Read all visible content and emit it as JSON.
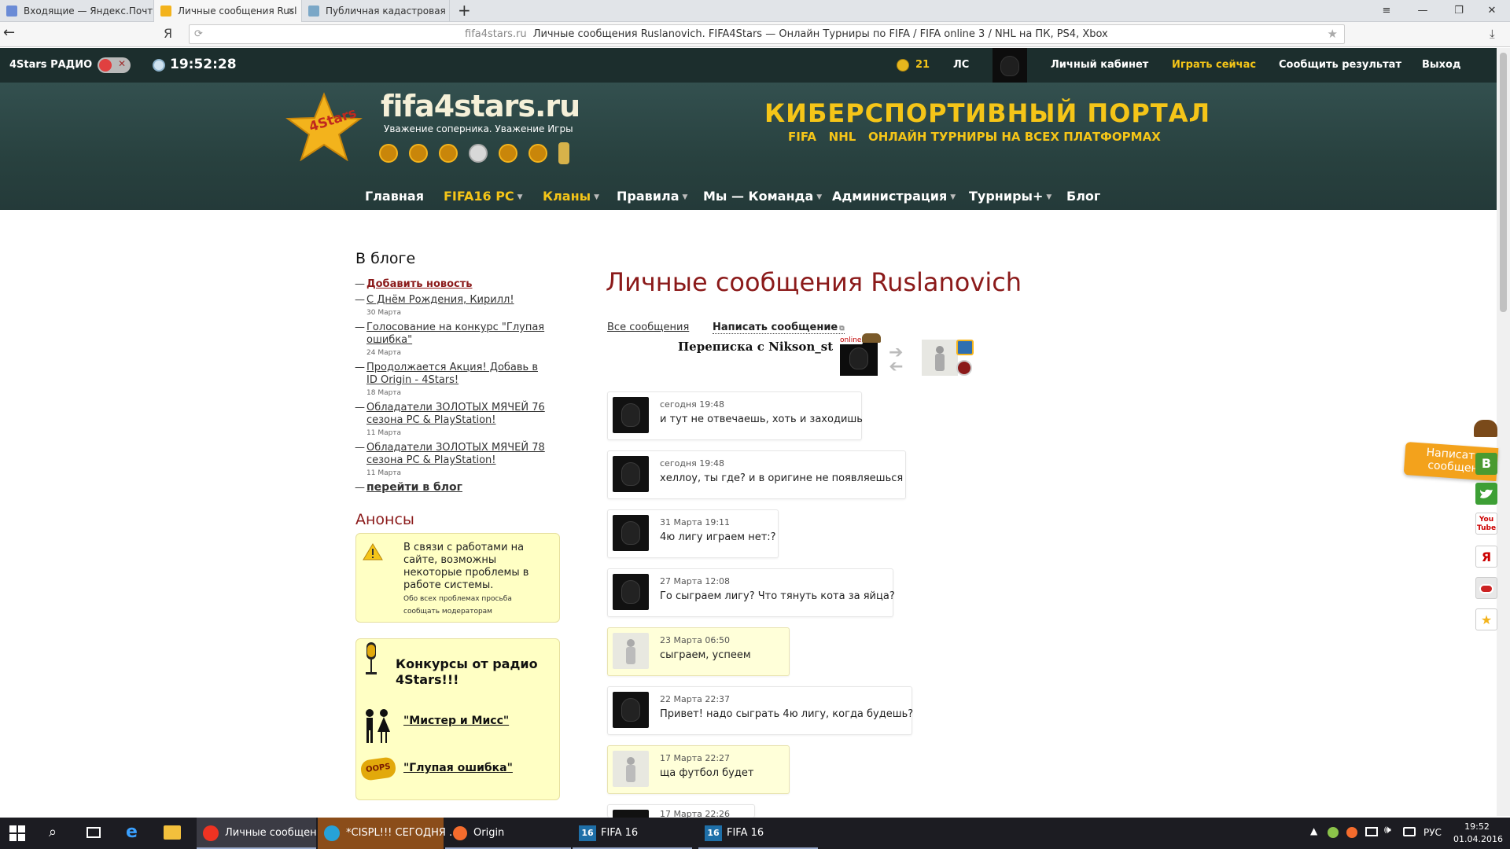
{
  "browser": {
    "tabs": [
      {
        "label": "Входящие — Яндекс.Почта",
        "active": false
      },
      {
        "label": "Личные сообщения Rusl",
        "active": true
      },
      {
        "label": "Публичная кадастровая карт",
        "active": false
      }
    ],
    "new_tab": "+",
    "yandex_logo": "Я",
    "reload_icon": "⟳",
    "address_host": "fifa4stars.ru",
    "address_title": "Личные сообщения Ruslanovich. FIFA4Stars — Онлайн Турниры по FIFA / FIFA online 3 / NHL на ПК, PS4, Xbox"
  },
  "topbar": {
    "radio_label": "4Stars РАДИО",
    "clock": "19:52:28",
    "coins": "21",
    "ls": "ЛС",
    "cabinet": "Личный кабинет",
    "play_now": "Играть сейчас",
    "report": "Сообщить результат",
    "logout": "Выход"
  },
  "header": {
    "site_name": "fifa4stars.ru",
    "logo_badge": "4Stars",
    "tagline": "Уважение соперника.  Уважение Игры",
    "portal_title": "КИБЕРСПОРТИВНЫЙ ПОРТАЛ",
    "portal_fifa": "FIFA",
    "portal_nhl": "NHL",
    "portal_sub": "ОНЛАЙН ТУРНИРЫ НА ВСЕХ ПЛАТФОРМАХ"
  },
  "nav": [
    {
      "label": "Главная"
    },
    {
      "label": "FIFA16 PC"
    },
    {
      "label": "Кланы"
    },
    {
      "label": "Правила"
    },
    {
      "label": "Мы — Команда"
    },
    {
      "label": "Администрация"
    },
    {
      "label": "Турниры+"
    },
    {
      "label": "Блог"
    }
  ],
  "sidebar": {
    "blog_heading": "В блоге",
    "add_news": "Добавить новость",
    "posts": [
      {
        "title": "С Днём Рождения, Кирилл!",
        "date": "30 Марта"
      },
      {
        "title": "Голосование на конкурс \"Глупая ошибка\"",
        "date": "24 Марта"
      },
      {
        "title": "Продолжается Акция! Добавь в ID Origin - 4Stars!",
        "date": "18 Марта"
      },
      {
        "title": "Обладатели ЗОЛОТЫХ МЯЧЕЙ 76 сезона PC & PlayStation!",
        "date": "11 Марта"
      },
      {
        "title": "Обладатели ЗОЛОТЫХ МЯЧЕЙ 78 сезона PC & PlayStation!",
        "date": "11 Марта"
      }
    ],
    "goto_blog": "перейти в блог",
    "announce_heading": "Анонсы",
    "announce_text": "В связи с работами на сайте, возможны некоторые проблемы в работе системы.",
    "announce_small": "Обо всех проблемах просьба сообщать модераторам",
    "contest_heading": "Конкурсы от радио 4Stars!!!",
    "contest_1": "\"Мистер и Мисс\"",
    "contest_2": "\"Глупая ошибка\"",
    "oops_badge": "OOPS"
  },
  "main": {
    "title": "Личные сообщения Ruslanovich",
    "all_messages": "Все сообщения",
    "write_message": "Написать сообщение",
    "conversation_with": "Переписка с Nikson_st",
    "online_badge": "online",
    "messages": [
      {
        "time": "сегодня 19:48",
        "text": "и тут не отвечаешь, хоть и заходишь",
        "mine": false
      },
      {
        "time": "сегодня 19:48",
        "text": "хеллоу, ты где? и в оригине не появляешься",
        "mine": false
      },
      {
        "time": "31 Марта 19:11",
        "text": "4ю лигу играем нет:?",
        "mine": false
      },
      {
        "time": "27 Марта 12:08",
        "text": "Го сыграем лигу? Что тянуть кота за яйца?",
        "mine": false
      },
      {
        "time": "23 Марта 06:50",
        "text": "сыграем, успеем",
        "mine": true
      },
      {
        "time": "22 Марта 22:37",
        "text": "Привет! надо сыграть 4ю лигу, когда будешь?",
        "mine": false
      },
      {
        "time": "17 Марта 22:27",
        "text": "ща футбол будет",
        "mine": true
      },
      {
        "time": "17 Марта 22:26",
        "text": "",
        "mine": false
      }
    ]
  },
  "floating": {
    "write_label": "Написать сообщен",
    "social": [
      "В",
      "Y",
      "You Tube",
      "Я",
      "",
      "★"
    ]
  },
  "taskbar": {
    "items": [
      {
        "label": "Личные сообщен..."
      },
      {
        "label": "*CISPL!!! СЕГОДНЯ ..."
      },
      {
        "label": "Origin"
      },
      {
        "label": "FIFA 16"
      },
      {
        "label": "FIFA 16"
      }
    ],
    "lang": "РУС",
    "time": "19:52",
    "date": "01.04.2016"
  },
  "colors": {
    "accent_red": "#8b1a1a",
    "nav_yellow": "#f5c518",
    "topbar_bg": "#1c2e2d",
    "note_bg": "#ffffd9"
  }
}
